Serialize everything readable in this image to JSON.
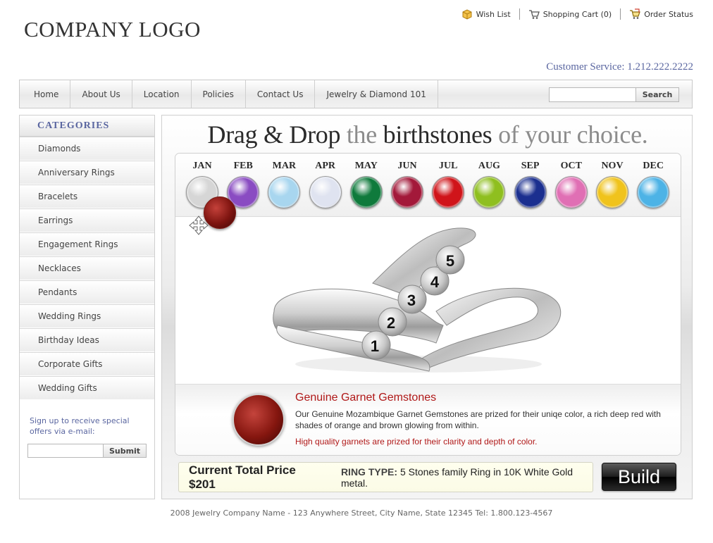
{
  "header": {
    "logo": "COMPANY LOGO",
    "links": [
      {
        "label": "Wish List",
        "icon": "box-icon"
      },
      {
        "label": "Shopping Cart (0)",
        "icon": "cart-icon"
      },
      {
        "label": "Order Status",
        "icon": "order-status-icon"
      }
    ],
    "customer_service": "Customer Service: 1.212.222.2222"
  },
  "nav": {
    "items": [
      "Home",
      "About Us",
      "Location",
      "Policies",
      "Contact Us",
      "Jewelry & Diamond 101"
    ],
    "search_placeholder": "",
    "search_button": "Search"
  },
  "sidebar": {
    "title": "CATEGORIES",
    "categories": [
      "Diamonds",
      "Anniversary Rings",
      "Bracelets",
      "Earrings",
      "Engagement Rings",
      "Necklaces",
      "Pendants",
      "Wedding Rings",
      "Birthday Ideas",
      "Corporate Gifts",
      "Wedding Gifts"
    ],
    "signup_text": "Sign up to receive special offers via e-mail:",
    "signup_button": "Submit"
  },
  "builder": {
    "headline": {
      "w1": "Drag & Drop",
      "w2": "the",
      "w3": "birthstones",
      "w4": "of your choice."
    },
    "months": [
      {
        "name": "JAN",
        "color": "#d6d6d6"
      },
      {
        "name": "FEB",
        "color": "#8a4cc2"
      },
      {
        "name": "MAR",
        "color": "#a8d6ef"
      },
      {
        "name": "APR",
        "color": "#dfe3f0"
      },
      {
        "name": "MAY",
        "color": "#0f7a3c"
      },
      {
        "name": "JUN",
        "color": "#a3193a"
      },
      {
        "name": "JUL",
        "color": "#d0141a"
      },
      {
        "name": "AUG",
        "color": "#8fbf1f"
      },
      {
        "name": "SEP",
        "color": "#1b2f8f"
      },
      {
        "name": "OCT",
        "color": "#e06fb4"
      },
      {
        "name": "NOV",
        "color": "#f0c31c"
      },
      {
        "name": "DEC",
        "color": "#4db3e6"
      }
    ],
    "ring_slots": [
      "1",
      "2",
      "3",
      "4",
      "5"
    ],
    "info": {
      "title": "Genuine Garnet Gemstones",
      "description": "Our Genuine Mozambique Garnet Gemstones are prized for their uniqe color, a rich deep red with shades of orange and brown glowing from within.",
      "note": "High quality garnets are prized for their clarity and depth of color."
    },
    "price": "Current Total Price $201",
    "ring_type_label": "RING TYPE:",
    "ring_type_value": "5 Stones family Ring in 10K White Gold metal.",
    "build_button": "Build"
  },
  "footer": {
    "text": "2008 Jewelry Company Name - 123 Anywhere Street, City Name, State 12345 Tel: 1.800.123-4567"
  },
  "colors": {
    "accent_blue": "#5a66a0",
    "garnet_red": "#b01818"
  }
}
